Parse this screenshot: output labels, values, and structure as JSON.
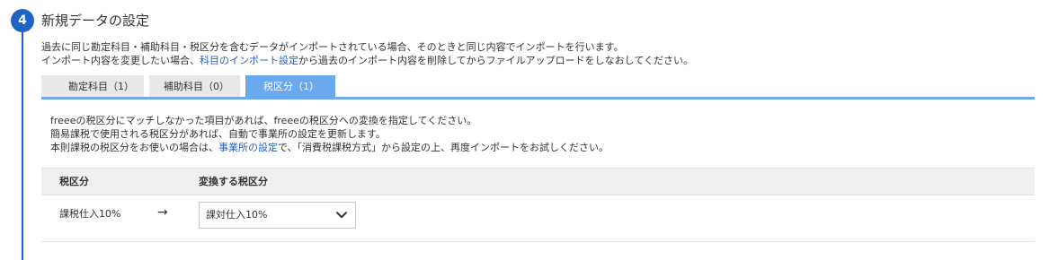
{
  "step": {
    "number": "4",
    "title": "新規データの設定"
  },
  "description": {
    "line1": "過去に同じ勘定科目・補助科目・税区分を含むデータがインポートされている場合、そのときと同じ内容でインポートを行います。",
    "line2_prefix": "インポート内容を変更したい場合、",
    "line2_link": "科目のインポート設定",
    "line2_suffix": "から過去のインポート内容を削除してからファイルアップロードをしなおしてください。"
  },
  "tabs": [
    {
      "label": "勘定科目（1）",
      "active": false
    },
    {
      "label": "補助科目（0）",
      "active": false
    },
    {
      "label": "税区分（1）",
      "active": true
    }
  ],
  "notice": {
    "line1": "freeeの税区分にマッチしなかった項目があれば、freeeの税区分への変換を指定してください。",
    "line2": "簡易課税で使用される税区分があれば、自動で事業所の設定を更新します。",
    "line3_prefix": "本則課税の税区分をお使いの場合は、",
    "line3_link": "事業所の設定",
    "line3_suffix": "で、「消費税課税方式」から設定の上、再度インポートをお試しください。"
  },
  "table": {
    "headers": [
      "税区分",
      "変換する税区分"
    ],
    "rows": [
      {
        "source": "課税仕入10%",
        "arrow": "→",
        "target": "課対仕入10%"
      }
    ]
  },
  "colors": {
    "accent": "#1e62c4",
    "active_tab": "#6ba9ef",
    "tab_bg": "#e8e8e8",
    "header_bg": "#f0f0f0"
  },
  "icons": {
    "dropdown": "chevron-down-icon",
    "arrow": "right-arrow"
  }
}
